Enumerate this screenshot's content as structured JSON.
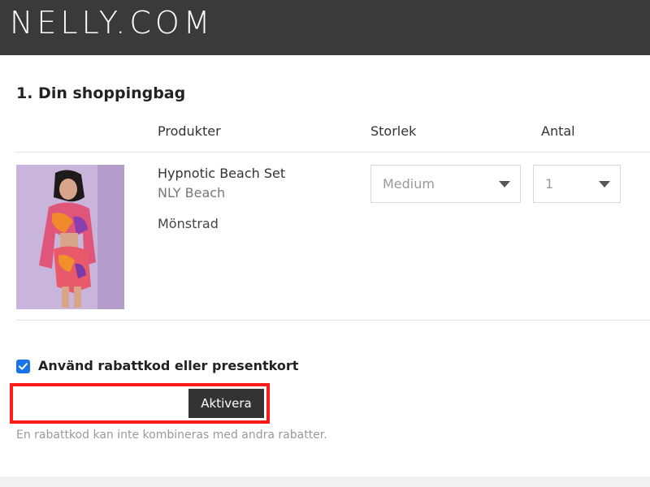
{
  "header": {
    "logo": "NELLY.COM"
  },
  "bag": {
    "title": "1. Din shoppingbag",
    "columns": {
      "products": "Produkter",
      "size": "Storlek",
      "quantity": "Antal"
    },
    "item": {
      "name": "Hypnotic Beach Set",
      "brand": "NLY Beach",
      "color": "Mönstrad",
      "size_value": "Medium",
      "quantity_value": "1"
    }
  },
  "discount": {
    "checkbox_label": "Använd rabattkod eller presentkort",
    "checked": true,
    "input_value": "",
    "button_label": "Aktivera",
    "hint": "En rabattkod kan inte kombineras med andra rabatter."
  },
  "colors": {
    "header_bg": "#3a3a3a",
    "button_bg": "#333333",
    "checkbox": "#1b73e8",
    "highlight_border": "#ff1a1a"
  },
  "icons": {
    "size_select": "chevron-down-icon",
    "qty_select": "chevron-down-icon",
    "checkbox": "checkmark-icon"
  }
}
